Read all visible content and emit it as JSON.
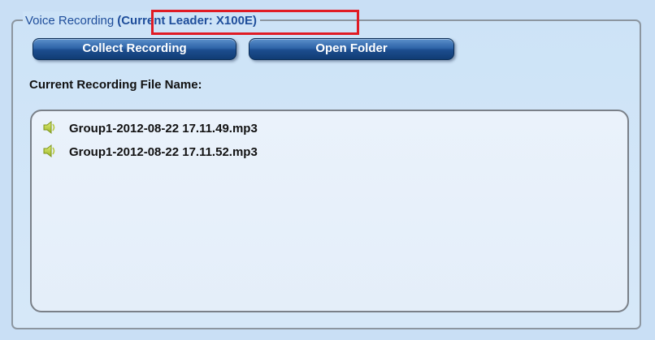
{
  "recording_panel": {
    "title": "Voice Recording",
    "leader_label": "(Current Leader: X100E)",
    "buttons": {
      "collect": "Collect Recording",
      "open_folder": "Open Folder"
    },
    "file_label": "Current Recording File Name:",
    "files": [
      {
        "name": "Group1-2012-08-22 17.11.49.mp3",
        "icon": "speaker-icon"
      },
      {
        "name": "Group1-2012-08-22 17.11.52.mp3",
        "icon": "speaker-icon"
      }
    ],
    "colors": {
      "panel_bg": "#c9dff5",
      "title_blue": "#1f4e9b",
      "button_blue": "#1c4d8e",
      "highlight_red": "#e01b24",
      "list_bg": "#eaf2fb"
    }
  }
}
